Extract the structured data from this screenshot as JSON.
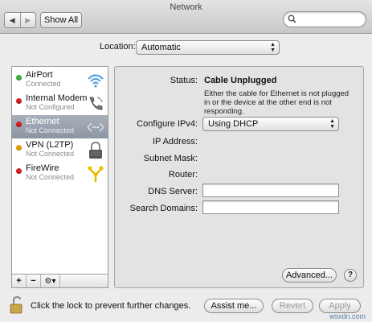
{
  "window": {
    "title": "Network"
  },
  "toolbar": {
    "back_glyph": "◀",
    "forward_glyph": "▶",
    "show_all_label": "Show All",
    "search_value": "",
    "search_placeholder": ""
  },
  "location": {
    "label": "Location:",
    "value": "Automatic"
  },
  "services": [
    {
      "name": "AirPort",
      "status": "Connected",
      "dot_color": "#3cb043",
      "icon": "wifi-icon"
    },
    {
      "name": "Internal Modem",
      "status": "Not Configured",
      "dot_color": "#d42020",
      "icon": "phone-icon"
    },
    {
      "name": "Ethernet",
      "status": "Not Connected",
      "dot_color": "#d42020",
      "icon": "ethernet-icon",
      "selected": true
    },
    {
      "name": "VPN (L2TP)",
      "status": "Not Connected",
      "dot_color": "#e0a100",
      "icon": "lock-icon"
    },
    {
      "name": "FireWire",
      "status": "Not Connected",
      "dot_color": "#d42020",
      "icon": "firewire-icon"
    }
  ],
  "sidebar_toolbar": {
    "add": "+",
    "remove": "−",
    "action": "⚙▾"
  },
  "detail": {
    "status_label": "Status:",
    "status_value": "Cable Unplugged",
    "status_description": "Either the cable for Ethernet is not plugged in or the device at the other end is not responding.",
    "configure_label": "Configure IPv4:",
    "configure_value": "Using DHCP",
    "ip_label": "IP Address:",
    "subnet_label": "Subnet Mask:",
    "router_label": "Router:",
    "dns_label": "DNS Server:",
    "dns_value": "",
    "search_domains_label": "Search Domains:",
    "search_domains_value": "",
    "advanced_label": "Advanced...",
    "help_label": "?"
  },
  "footer": {
    "lock_text": "Click the lock to prevent further changes.",
    "assist_label": "Assist me...",
    "revert_label": "Revert",
    "apply_label": "Apply"
  },
  "watermark": "wsxdn.com",
  "colors": {
    "selected_row": "#9aa3ae",
    "panel_bg": "#e3e3e3"
  }
}
